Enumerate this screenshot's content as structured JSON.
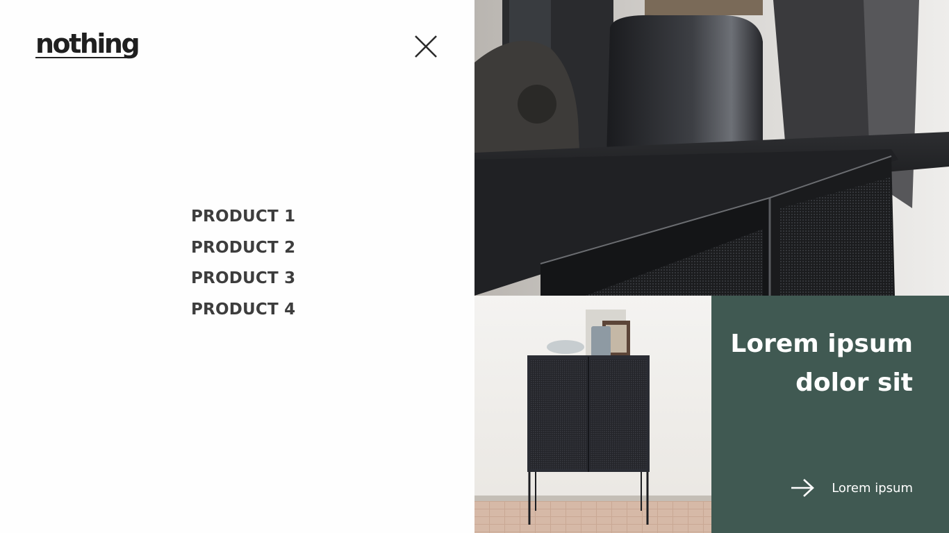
{
  "brand": {
    "logo_text": "nothing"
  },
  "menu": {
    "items": [
      {
        "label": "PRODUCT 1"
      },
      {
        "label": "PRODUCT 2"
      },
      {
        "label": "PRODUCT 3"
      },
      {
        "label": "PRODUCT 4"
      }
    ]
  },
  "icons": {
    "close": "close-icon",
    "arrow": "arrow-right-icon"
  },
  "promo": {
    "title_line1": "Lorem ipsum",
    "title_line2": "dolor sit",
    "link_label": "Lorem ipsum",
    "background_color": "#405952"
  }
}
